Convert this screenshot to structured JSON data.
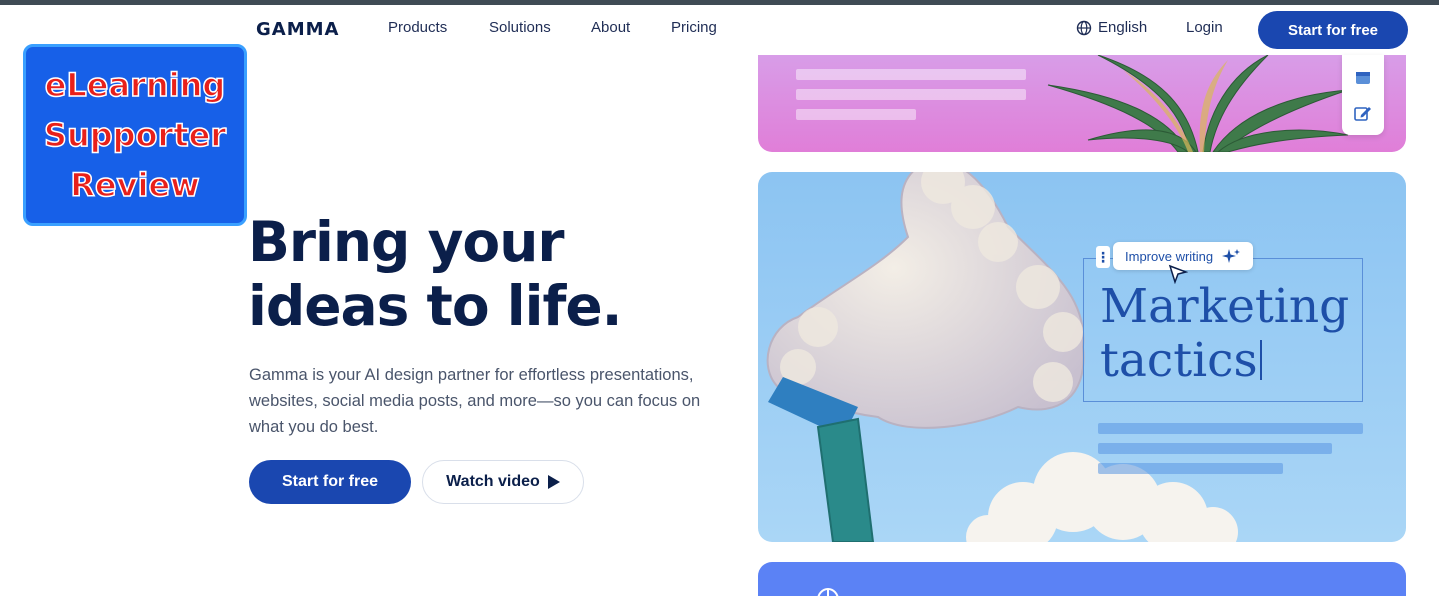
{
  "nav": {
    "logo": "GAMMA",
    "links": [
      "Products",
      "Solutions",
      "About",
      "Pricing"
    ],
    "language": "English",
    "login": "Login",
    "cta": "Start for free"
  },
  "badge": {
    "lines": [
      "eLearning",
      "Supporter",
      "Review"
    ]
  },
  "hero": {
    "title_line1": "Bring your",
    "title_line2": "ideas to life.",
    "subtitle": "Gamma is your AI design partner for effortless presentations, websites, social media posts, and more—so you can focus on what you do best.",
    "primary_cta": "Start for free",
    "secondary_cta": "Watch video"
  },
  "showcase": {
    "ai_pill": "Improve writing",
    "heading_line1": "Marketing",
    "heading_line2": "tactics"
  },
  "colors": {
    "brand_blue": "#1a47b0",
    "navy_text": "#0b1f4a",
    "badge_blue": "#1760e8",
    "badge_red": "#e8201a"
  }
}
